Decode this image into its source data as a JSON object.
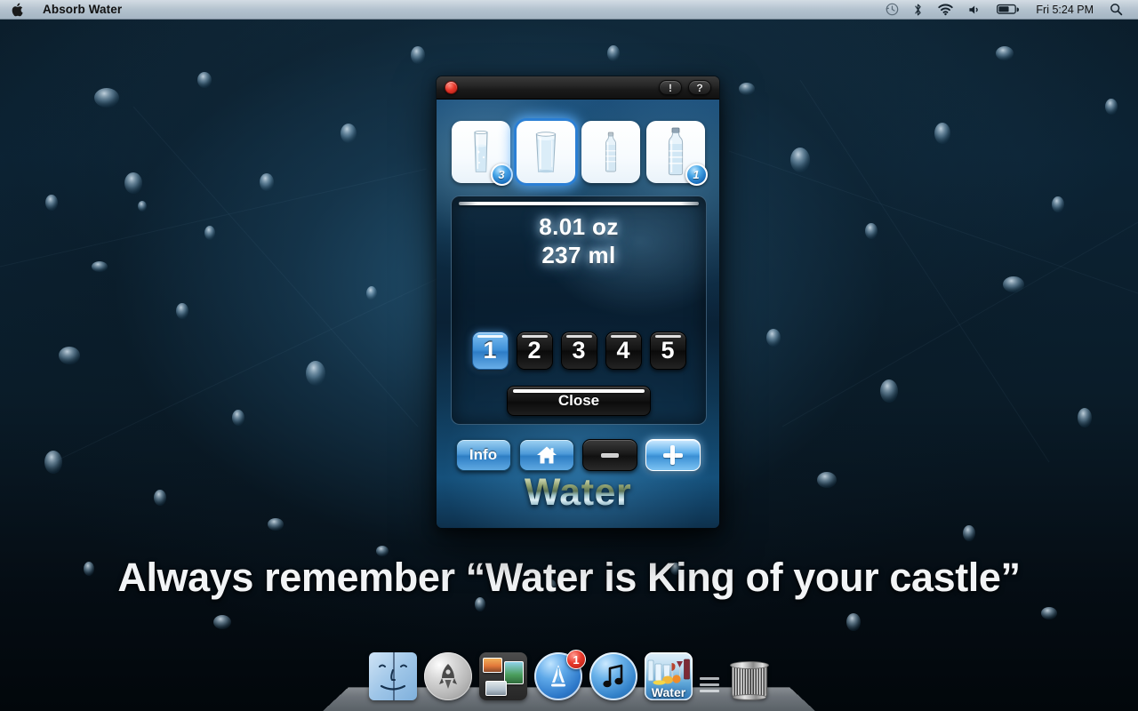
{
  "menubar": {
    "apple_icon": "apple-logo",
    "app_title": "Absorb Water",
    "status_icons": [
      "time-machine-icon",
      "bluetooth-icon",
      "wifi-icon",
      "volume-icon",
      "battery-icon"
    ],
    "clock": "Fri 5:24 PM",
    "spotlight_icon": "search-icon"
  },
  "window": {
    "titlebar": {
      "close_icon": "close-button",
      "alert_label": "!",
      "help_label": "?"
    },
    "containers": [
      {
        "name": "tall-glass",
        "icon": "tall-water-glass-icon",
        "badge": "3",
        "selected": false
      },
      {
        "name": "drinking-glass",
        "icon": "full-water-glass-icon",
        "badge": "",
        "selected": true
      },
      {
        "name": "small-bottle",
        "icon": "small-water-bottle-icon",
        "badge": "",
        "selected": false
      },
      {
        "name": "large-bottle",
        "icon": "large-water-bottle-icon",
        "badge": "1",
        "selected": false
      }
    ],
    "measurement": {
      "ounces": "8.01 oz",
      "milliliters": "237 ml"
    },
    "numpad": [
      {
        "label": "1",
        "selected": true
      },
      {
        "label": "2",
        "selected": false
      },
      {
        "label": "3",
        "selected": false
      },
      {
        "label": "4",
        "selected": false
      },
      {
        "label": "5",
        "selected": false
      }
    ],
    "close_action_label": "Close",
    "toolbar": {
      "info_label": "Info",
      "home_icon": "home-icon",
      "minus_icon": "minus-icon",
      "plus_icon": "plus-icon"
    },
    "wordmark": "Water"
  },
  "desktop": {
    "tagline": "Always remember “Water is King of your castle”"
  },
  "dock": {
    "items": [
      {
        "name": "finder",
        "label": "Finder",
        "badge": ""
      },
      {
        "name": "launchpad",
        "label": "Launchpad",
        "badge": ""
      },
      {
        "name": "iphoto",
        "label": "iPhoto",
        "badge": ""
      },
      {
        "name": "app-store",
        "label": "App Store",
        "badge": "1"
      },
      {
        "name": "itunes",
        "label": "iTunes",
        "badge": ""
      },
      {
        "name": "water",
        "label": "Water",
        "badge": ""
      },
      {
        "name": "trash",
        "label": "Trash",
        "badge": ""
      }
    ],
    "water_icon_label": "Water"
  },
  "colors": {
    "accent_blue": "#3a8fd4",
    "badge_red": "#e8392b",
    "selected_glow": "#5aafff",
    "wallpaper_deep": "#0a1c29"
  }
}
